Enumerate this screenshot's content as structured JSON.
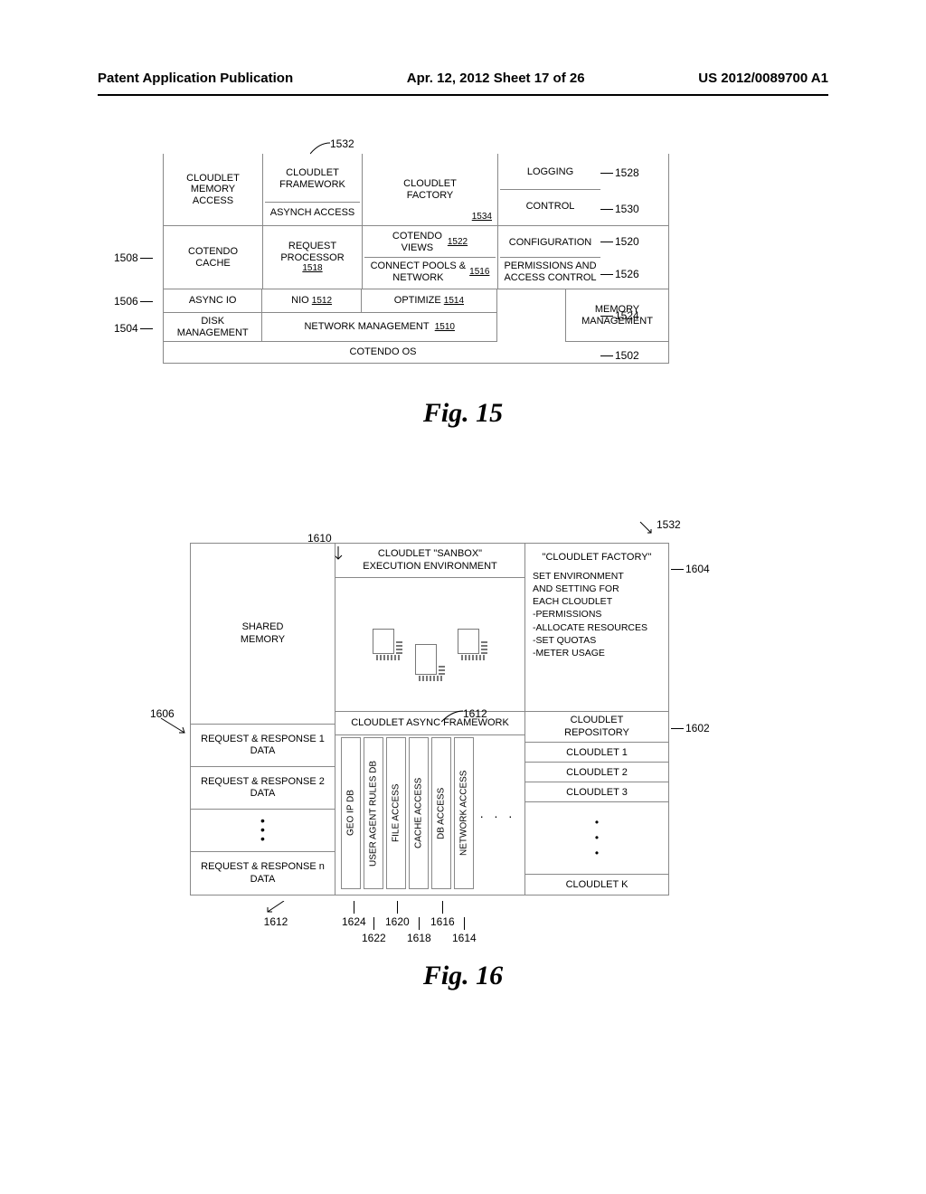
{
  "header": {
    "left": "Patent Application Publication",
    "center": "Apr. 12, 2012  Sheet 17 of 26",
    "right": "US 2012/0089700 A1"
  },
  "fig15": {
    "caption": "Fig. 15",
    "top_callout": "1532",
    "left_callouts": {
      "l1508": "1508",
      "l1506": "1506",
      "l1504": "1504"
    },
    "right_callouts": {
      "r1528": "1528",
      "r1530": "1530",
      "r1520": "1520",
      "r1526": "1526",
      "r1524": "1524",
      "r1502": "1502"
    },
    "cells": {
      "cloudlet_memory_access": "CLOUDLET\nMEMORY\nACCESS",
      "cloudlet_framework": "CLOUDLET\nFRAMEWORK",
      "asynch_access": "ASYNCH ACCESS",
      "cloudlet_factory": "CLOUDLET\nFACTORY",
      "cloudlet_factory_ref": "1534",
      "logging": "LOGGING",
      "control": "CONTROL",
      "cotendo_cache": "COTENDO\nCACHE",
      "request_processor": "REQUEST\nPROCESSOR",
      "request_processor_ref": "1518",
      "cotendo_views": "COTENDO\nVIEWS",
      "cotendo_views_ref": "1522",
      "connect_pools": "CONNECT POOLS &\nNETWORK",
      "connect_pools_ref": "1516",
      "configuration": "CONFIGURATION",
      "permissions": "PERMISSIONS AND\nACCESS CONTROL",
      "async_io": "ASYNC IO",
      "nio": "NIO",
      "nio_ref": "1512",
      "optimize": "OPTIMIZE",
      "optimize_ref": "1514",
      "memory_mgmt": "MEMORY\nMANAGEMENT",
      "disk_mgmt": "DISK\nMANAGEMENT",
      "network_mgmt": "NETWORK  MANAGEMENT",
      "network_mgmt_ref": "1510",
      "cotendo_os": "COTENDO OS"
    }
  },
  "fig16": {
    "caption": "Fig. 16",
    "top_right_ref": "1532",
    "callouts": {
      "c1610": "1610",
      "c1604": "1604",
      "c1606": "1606",
      "c1602": "1602",
      "c1612a": "1612",
      "c1612b": "1612",
      "c1624": "1624",
      "c1622": "1622",
      "c1620": "1620",
      "c1618": "1618",
      "c1616": "1616",
      "c1614": "1614"
    },
    "colA": {
      "shared": "SHARED\nMEMORY",
      "rr1": "REQUEST & RESPONSE 1\nDATA",
      "rr2": "REQUEST & RESPONSE 2\nDATA",
      "rrn": "REQUEST & RESPONSE n\nDATA"
    },
    "colB": {
      "sandbox_title": "CLOUDLET  \"SANBOX\"\nEXECUTION  ENVIRONMENT",
      "async_fw": "CLOUDLET ASYNC FRAMEWORK",
      "services": [
        "GEO IP DB",
        "USER AGENT RULES DB",
        "FILE ACCESS",
        "CACHE ACCESS",
        "DB ACCESS",
        "NETWORK ACCESS"
      ],
      "svc_dots": ". . ."
    },
    "colC": {
      "factory_title": "\"CLOUDLET FACTORY\"",
      "factory_lines": [
        "SET ENVIRONMENT",
        "AND SETTING FOR",
        "EACH CLOUDLET",
        "-PERMISSIONS",
        "-ALLOCATE RESOURCES",
        "-SET QUOTAS",
        "-METER USAGE"
      ],
      "repo_title": "CLOUDLET\nREPOSITORY",
      "items": [
        "CLOUDLET 1",
        "CLOUDLET 2",
        "CLOUDLET 3"
      ],
      "last": "CLOUDLET K"
    }
  }
}
